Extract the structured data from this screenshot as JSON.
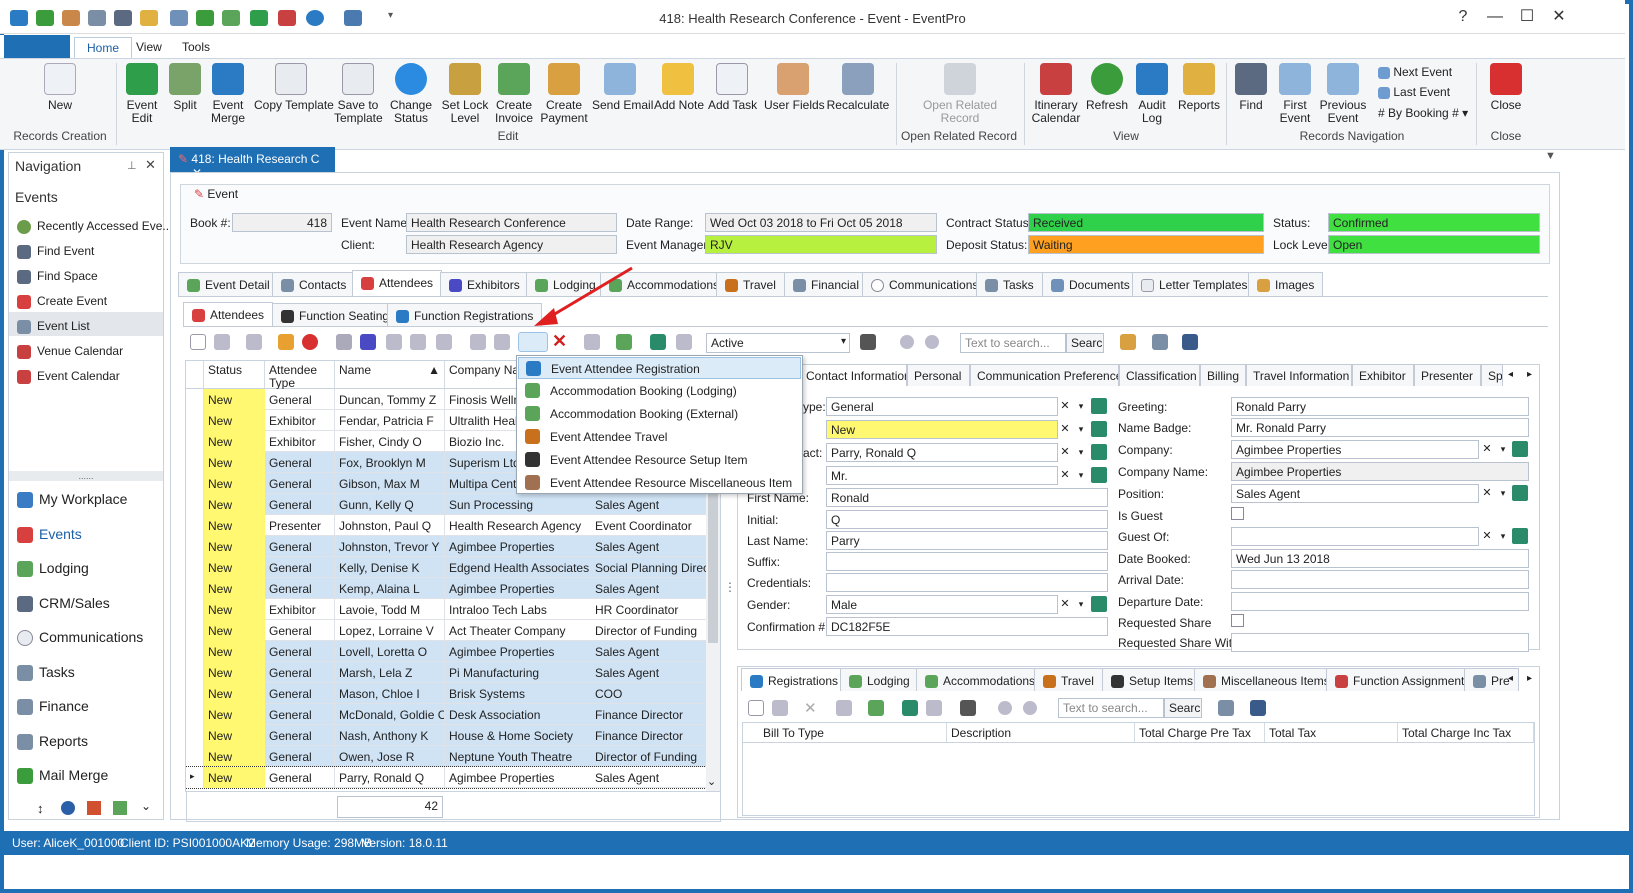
{
  "window": {
    "title": "418: Health Research Conference - Event - EventPro"
  },
  "ribbon_tabs": [
    "Home",
    "View",
    "Tools"
  ],
  "ribbon": {
    "records_creation": {
      "label": "Records Creation",
      "new": "New"
    },
    "edit": {
      "label": "Edit",
      "event_edit": "Event\nEdit",
      "split": "Split",
      "event_merge": "Event\nMerge",
      "copy_template": "Copy Template",
      "save_to_template": "Save to\nTemplate",
      "change_status": "Change\nStatus",
      "set_lock_level": "Set Lock\nLevel",
      "create_invoice": "Create\nInvoice",
      "create_payment": "Create\nPayment",
      "send_email": "Send Email",
      "add_note": "Add Note",
      "add_task": "Add Task",
      "user_fields": "User Fields",
      "recalculate": "Recalculate"
    },
    "open_related": {
      "label": "Open Related Record",
      "button": "Open Related\nRecord"
    },
    "view": {
      "label": "View",
      "itinerary": "Itinerary\nCalendar",
      "refresh": "Refresh",
      "audit": "Audit\nLog",
      "reports": "Reports"
    },
    "nav": {
      "label": "Records Navigation",
      "find": "Find",
      "first": "First\nEvent",
      "previous": "Previous\nEvent",
      "next": "Next Event",
      "last": "Last Event",
      "by_booking": "By Booking #"
    },
    "close": {
      "label": "Close",
      "button": "Close"
    }
  },
  "navigation": {
    "title": "Navigation",
    "section": "Events",
    "items": [
      "Recently Accessed Eve...",
      "Find Event",
      "Find Space",
      "Create Event",
      "Event List",
      "Venue Calendar",
      "Event Calendar"
    ],
    "modules": [
      "My Workplace",
      "Events",
      "Lodging",
      "CRM/Sales",
      "Communications",
      "Tasks",
      "Finance",
      "Reports",
      "Mail Merge"
    ]
  },
  "doc_tab": "418: Health Research C",
  "event": {
    "section": "Event",
    "book_label": "Book #:",
    "book": "418",
    "name_label": "Event Name:",
    "name": "Health Research Conference",
    "client_label": "Client:",
    "client": "Health Research Agency",
    "date_label": "Date Range:",
    "date": "Wed Oct 03 2018 to Fri Oct 05 2018",
    "manager_label": "Event Manager:",
    "manager": "RJV",
    "contract_label": "Contract Status:",
    "contract": "Received",
    "deposit_label": "Deposit Status:",
    "deposit": "Waiting",
    "status_label": "Status:",
    "status": "Confirmed",
    "lock_label": "Lock Level:",
    "lock": "Open"
  },
  "main_tabs": [
    "Event Detail",
    "Contacts",
    "Attendees",
    "Exhibitors",
    "Lodging",
    "Accommodations",
    "Travel",
    "Financial",
    "Communications",
    "Tasks",
    "Documents",
    "Letter Templates",
    "Images"
  ],
  "sub_tabs": [
    "Attendees",
    "Function Seating",
    "Function Registrations"
  ],
  "toolbar": {
    "filter": "Active",
    "search_placeholder": "Text to search...",
    "search_btn": "Search"
  },
  "menu": [
    "Event Attendee Registration",
    "Accommodation Booking (Lodging)",
    "Accommodation Booking (External)",
    "Event Attendee Travel",
    "Event Attendee Resource Setup Item",
    "Event Attendee Resource Miscellaneous Item"
  ],
  "grid": {
    "headers": [
      "Status",
      "Attendee\nType",
      "Name",
      "Company Name"
    ],
    "rows": [
      [
        "New",
        "General",
        "Duncan, Tommy Z",
        "Finosis Wellness",
        ""
      ],
      [
        "New",
        "Exhibitor",
        "Fendar, Patricia F",
        "Ultralith Health",
        ""
      ],
      [
        "New",
        "Exhibitor",
        "Fisher, Cindy O",
        "Biozio Inc.",
        ""
      ],
      [
        "New",
        "General",
        "Fox, Brooklyn M",
        "Superism Ltd.",
        ""
      ],
      [
        "New",
        "General",
        "Gibson, Max M",
        "Multipa Center",
        ""
      ],
      [
        "New",
        "General",
        "Gunn, Kelly Q",
        "Sun Processing",
        "Sales Agent"
      ],
      [
        "New",
        "Presenter",
        "Johnston, Paul Q",
        "Health Research Agency",
        "Event Coordinator"
      ],
      [
        "New",
        "General",
        "Johnston, Trevor Y",
        "Agimbee Properties",
        "Sales Agent"
      ],
      [
        "New",
        "General",
        "Kelly, Denise K",
        "Edgend Health Associates",
        "Social Planning Direc..."
      ],
      [
        "New",
        "General",
        "Kemp, Alaina L",
        "Agimbee Properties",
        "Sales Agent"
      ],
      [
        "New",
        "Exhibitor",
        "Lavoie, Todd M",
        "Intraloo Tech Labs",
        "HR Coordinator"
      ],
      [
        "New",
        "General",
        "Lopez, Lorraine V",
        "Act Theater Company",
        "Director of Funding"
      ],
      [
        "New",
        "General",
        "Lovell, Loretta O",
        "Agimbee Properties",
        "Sales Agent"
      ],
      [
        "New",
        "General",
        "Marsh, Lela Z",
        "Pi Manufacturing",
        "Sales Agent"
      ],
      [
        "New",
        "General",
        "Mason, Chloe I",
        "Brisk Systems",
        "COO"
      ],
      [
        "New",
        "General",
        "McDonald, Goldie C",
        "Desk Association",
        "Finance Director"
      ],
      [
        "New",
        "General",
        "Nash, Anthony K",
        "House & Home Society",
        "Finance Director"
      ],
      [
        "New",
        "General",
        "Owen, Jose R",
        "Neptune Youth Theatre",
        "Director of Funding"
      ],
      [
        "New",
        "General",
        "Parry, Ronald Q",
        "Agimbee Properties",
        "Sales Agent"
      ]
    ],
    "count": "42"
  },
  "detail_tabs": [
    "Contact Information",
    "Personal",
    "Communication Preferences",
    "Classification",
    "Billing",
    "Travel Information",
    "Exhibitor",
    "Presenter",
    "Sp"
  ],
  "detail": {
    "type_label": "ype:",
    "type": "General",
    "status_val": "New",
    "contact_label": "act:",
    "contact": "Parry, Ronald Q",
    "title_val": "Mr.",
    "first_label": "First Name:",
    "first": "Ronald",
    "initial_label": "Initial:",
    "initial": "Q",
    "last_label": "Last Name:",
    "last": "Parry",
    "suffix_label": "Suffix:",
    "cred_label": "Credentials:",
    "gender_label": "Gender:",
    "gender": "Male",
    "conf_label": "Confirmation #:",
    "conf": "DC182F5E",
    "greeting_label": "Greeting:",
    "greeting": "Ronald Parry",
    "badge_label": "Name Badge:",
    "badge": "Mr. Ronald Parry",
    "company_label": "Company:",
    "company": "Agimbee Properties",
    "company_name_label": "Company Name:",
    "company_name": "Agimbee Properties",
    "position_label": "Position:",
    "position": "Sales Agent",
    "guest_label": "Is Guest",
    "guestof_label": "Guest Of:",
    "booked_label": "Date Booked:",
    "booked": "Wed Jun 13 2018",
    "arrival_label": "Arrival Date:",
    "departure_label": "Departure Date:",
    "req_share_label": "Requested Share",
    "req_share_with_label": "Requested Share With:"
  },
  "bottom_tabs": [
    "Registrations",
    "Lodging",
    "Accommodations",
    "Travel",
    "Setup Items",
    "Miscellaneous Items",
    "Function Assignments",
    "Pre"
  ],
  "bottom_grid": {
    "headers": [
      "Bill To Type",
      "Description",
      "Total Charge Pre Tax",
      "Total Tax",
      "Total Charge Inc Tax"
    ]
  },
  "status_bar": {
    "user": "User: AliceK_001000",
    "client": "Client ID: PSI001000AK2",
    "memory": "Memory Usage: 298MB",
    "version": "Version: 18.0.11"
  }
}
